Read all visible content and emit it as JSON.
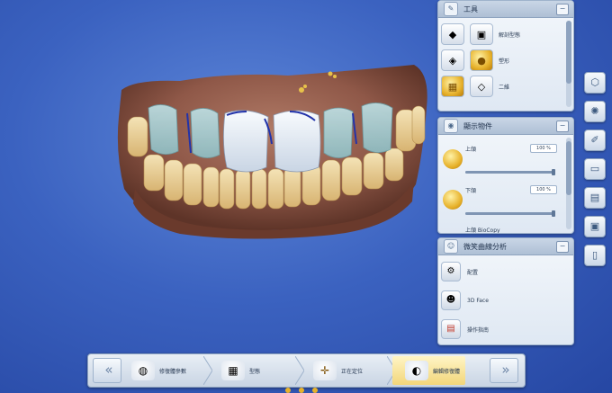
{
  "tools_panel": {
    "title": "工具",
    "items": [
      {
        "label": "解剖型態",
        "icon": "tooth-anatomy-icon"
      },
      {
        "label": "塑形",
        "icon": "shape-tooth-icon"
      },
      {
        "label": "二維",
        "icon": "two-d-icon"
      }
    ]
  },
  "display_panel": {
    "title": "顯示物件",
    "objects": [
      {
        "label": "上頜",
        "percent": "100 %",
        "opacity": 1.0
      },
      {
        "label": "下頜",
        "percent": "100 %",
        "opacity": 1.0
      },
      {
        "label": "上頜 BioCopy"
      }
    ]
  },
  "smile_panel": {
    "title": "微笑曲線分析",
    "items": [
      {
        "label": "配置",
        "icon": "gear-icon"
      },
      {
        "label": "3D Face",
        "icon": "face-3d-icon"
      },
      {
        "label": "操作指南",
        "icon": "guide-icon"
      }
    ]
  },
  "workflow": {
    "steps": [
      {
        "label": "修復體參數"
      },
      {
        "label": "型態"
      },
      {
        "label": "正在定位"
      },
      {
        "label": "編輯修復體",
        "active": true
      }
    ]
  },
  "colors": {
    "background": "#3b62c0",
    "panel": "#e6edf5",
    "active_step": "#f2d67a"
  }
}
